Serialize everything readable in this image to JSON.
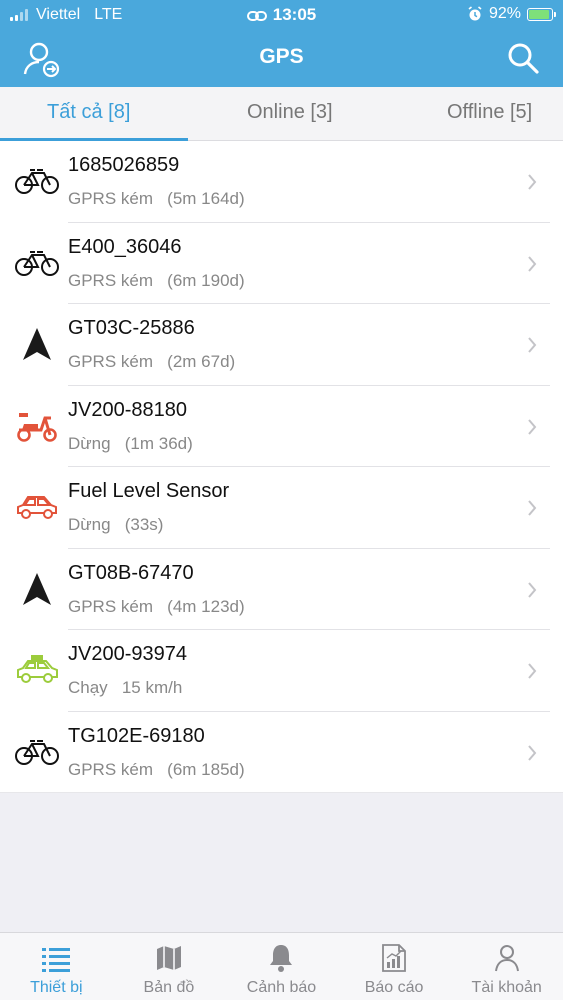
{
  "status_bar": {
    "carrier": "Viettel",
    "network": "LTE",
    "time": "13:05",
    "battery": "92%",
    "battery_level": 0.92
  },
  "header": {
    "title": "GPS",
    "left_icon": "user-switch-icon",
    "right_icon": "search-icon"
  },
  "tabs": [
    {
      "label": "Tất cả [8]",
      "active": true
    },
    {
      "label": "Online [3]",
      "active": false
    },
    {
      "label": "Offline [5]",
      "active": false
    }
  ],
  "devices": [
    {
      "name": "1685026859",
      "status": "GPRS kém   (5m 164d)",
      "icon": "bicycle-icon",
      "color": "#111111"
    },
    {
      "name": "E400_36046",
      "status": "GPRS kém   (6m 190d)",
      "icon": "bicycle-icon",
      "color": "#111111"
    },
    {
      "name": "GT03C-25886",
      "status": "GPRS kém   (2m 67d)",
      "icon": "navigation-arrow-icon",
      "color": "#1a1a1a"
    },
    {
      "name": "JV200-88180",
      "status": "Dừng   (1m 36d)",
      "icon": "scooter-icon",
      "color": "#e2533a"
    },
    {
      "name": "Fuel Level Sensor",
      "status": "Dừng   (33s)",
      "icon": "car-icon",
      "color": "#e2533a"
    },
    {
      "name": "GT08B-67470",
      "status": "GPRS kém   (4m 123d)",
      "icon": "navigation-arrow-icon",
      "color": "#1a1a1a"
    },
    {
      "name": "JV200-93974",
      "status": "Chạy   15 km/h",
      "icon": "taxi-icon",
      "color": "#9ccc3c"
    },
    {
      "name": "TG102E-69180",
      "status": "GPRS kém   (6m 185d)",
      "icon": "bicycle-icon",
      "color": "#111111"
    }
  ],
  "bottom_tabs": [
    {
      "label": "Thiết bị",
      "icon": "list-icon",
      "active": true
    },
    {
      "label": "Bản đồ",
      "icon": "map-icon",
      "active": false
    },
    {
      "label": "Cảnh báo",
      "icon": "bell-icon",
      "active": false
    },
    {
      "label": "Báo cáo",
      "icon": "report-chart-icon",
      "active": false
    },
    {
      "label": "Tài khoản",
      "icon": "account-icon",
      "active": false
    }
  ],
  "colors": {
    "header_bg": "#4aa8dc",
    "accent": "#3c9fd9",
    "status_ok": "#9ccc3c",
    "status_stop": "#e2533a"
  }
}
